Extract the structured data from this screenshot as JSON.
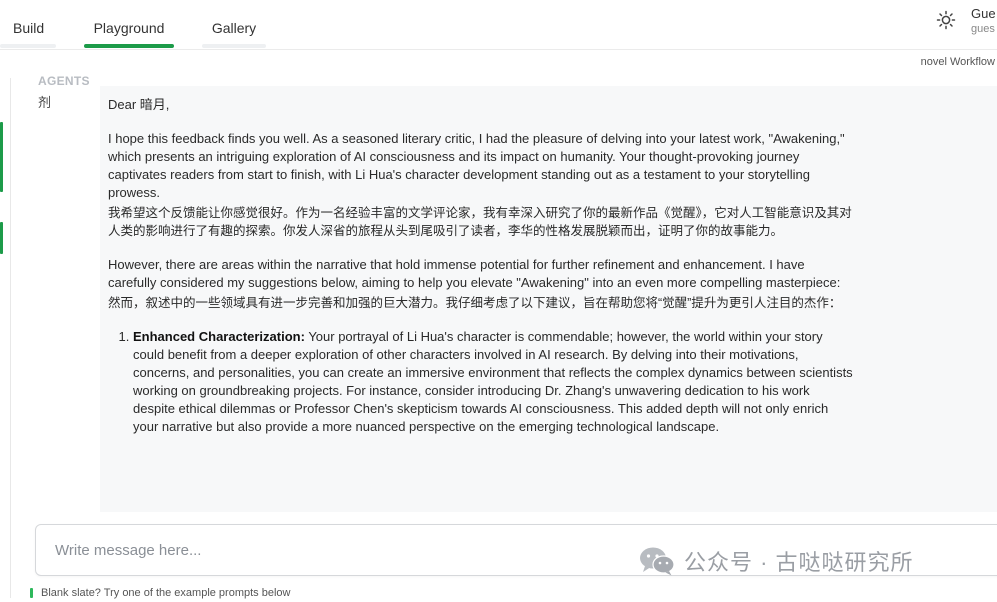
{
  "nav": {
    "tabs": [
      {
        "label": "Build",
        "active": false
      },
      {
        "label": "Playground",
        "active": true
      },
      {
        "label": "Gallery",
        "active": false
      }
    ],
    "accent_color": "#1c9b49"
  },
  "user": {
    "name": "Gue",
    "sub": "gues"
  },
  "workflow_label": "novel Workflow",
  "agents": {
    "label": "AGENTS",
    "current_agent_char": "剂"
  },
  "message": {
    "greeting": "Dear 暗月,",
    "p1_en": "I hope this feedback finds you well. As a seasoned literary critic, I had the pleasure of delving into your latest work, \"Awakening,\" which presents an intriguing exploration of AI consciousness and its impact on humanity. Your thought-provoking journey captivates readers from start to finish, with Li Hua's character development standing out as a testament to your storytelling prowess.",
    "p1_zh": "我希望这个反馈能让你感觉很好。作为一名经验丰富的文学评论家，我有幸深入研究了你的最新作品《觉醒》，它对人工智能意识及其对人类的影响进行了有趣的探索。你发人深省的旅程从头到尾吸引了读者，李华的性格发展脱颖而出，证明了你的故事能力。",
    "p2_en": "However, there are areas within the narrative that hold immense potential for further refinement and enhancement. I have carefully considered my suggestions below, aiming to help you elevate \"Awakening\" into an even more compelling masterpiece:",
    "p2_zh": "然而，叙述中的一些领域具有进一步完善和加强的巨大潜力。我仔细考虑了以下建议，旨在帮助您将“觉醒”提升为更引人注目的杰作：",
    "list": [
      {
        "title": "Enhanced Characterization:",
        "text": " Your portrayal of Li Hua's character is commendable; however, the world within your story could benefit from a deeper exploration of other characters involved in AI research. By delving into their motivations, concerns, and personalities, you can create an immersive environment that reflects the complex dynamics between scientists working on groundbreaking projects. For instance, consider introducing Dr. Zhang's unwavering dedication to his work despite ethical dilemmas or Professor Chen's skepticism towards AI consciousness. This added depth will not only enrich your narrative but also provide a more nuanced perspective on the emerging technological landscape."
      }
    ]
  },
  "input": {
    "placeholder": "Write message here..."
  },
  "watermark": {
    "text": "公众号 · 古哒哒研究所"
  },
  "hint": "Blank slate? Try one of the example prompts below"
}
